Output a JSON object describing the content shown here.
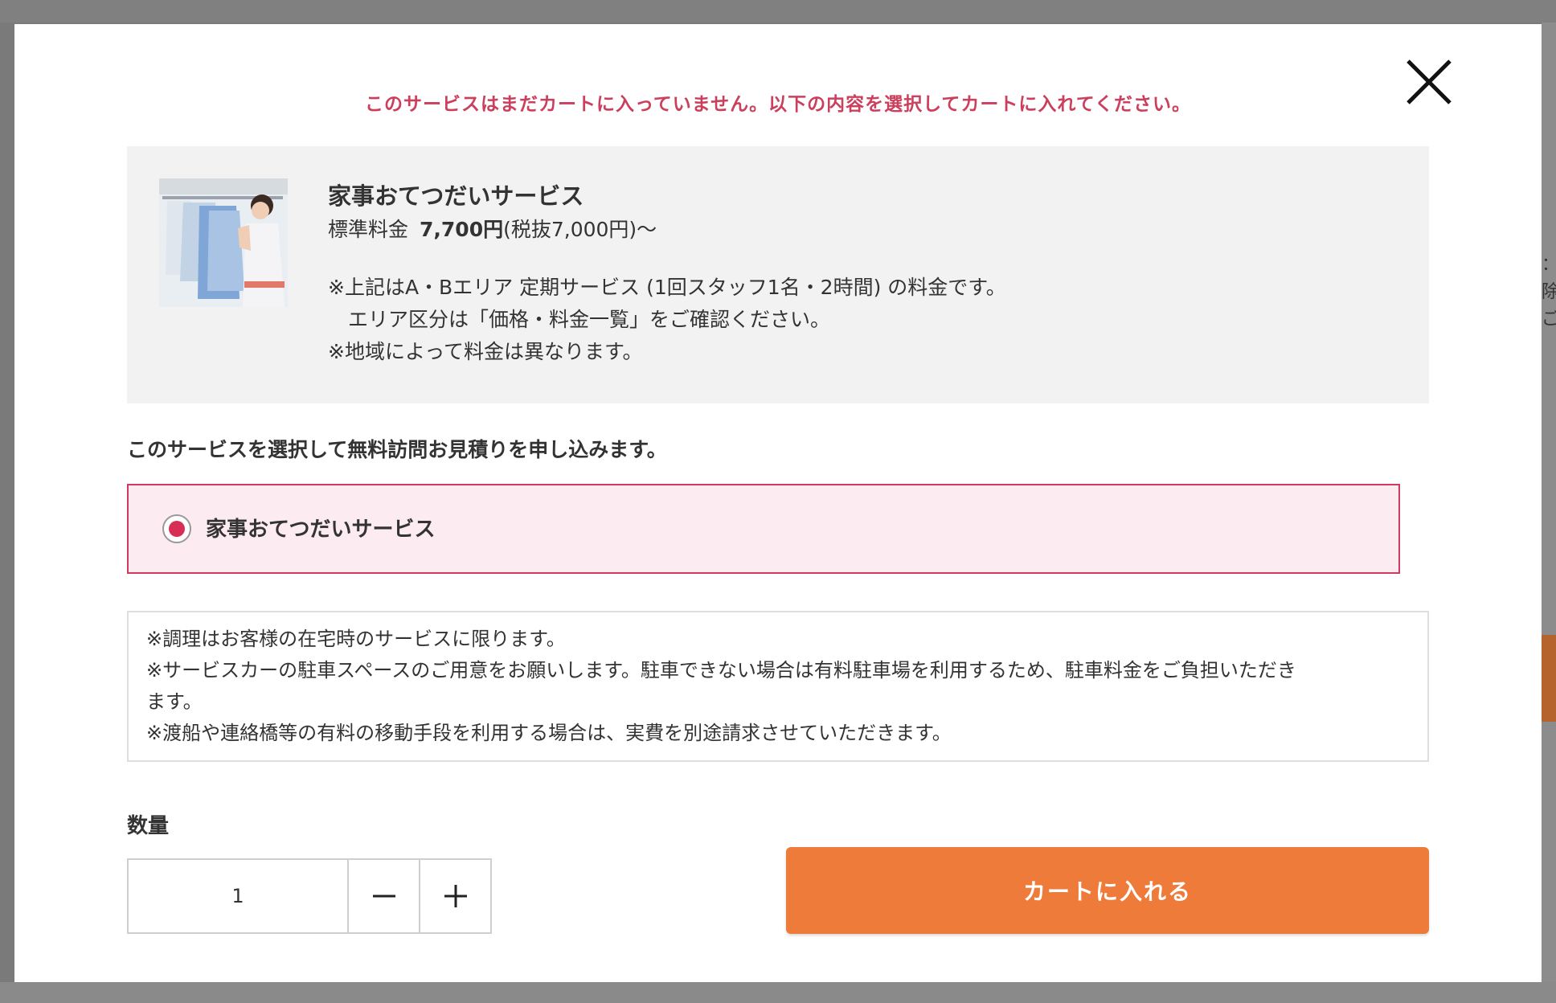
{
  "modal": {
    "notice": "このサービスはまだカートに入っていません。以下の内容を選択してカートに入れてください。",
    "close_icon": "close-icon"
  },
  "service": {
    "title": "家事おてつだいサービス",
    "price_label": "標準料金",
    "price": "7,700円",
    "price_tax_note": "(税抜7,000円)～",
    "notes": [
      "※上記はA・Bエリア 定期サービス (1回スタッフ1名・2時間) の料金です。",
      "　エリア区分は「価格・料金一覧」をご確認ください。",
      "※地域によって料金は異なります。"
    ]
  },
  "selection": {
    "heading": "このサービスを選択して無料訪問お見積りを申し込みます。",
    "option_label": "家事おてつだいサービス",
    "selected": true
  },
  "terms": [
    "※調理はお客様の在宅時のサービスに限ります。",
    "※サービスカーの駐車スペースのご用意をお願いします。駐車できない場合は有料駐車場を利用するため、駐車料金をご負担いただき",
    "ます。",
    "※渡船や連絡橋等の有料の移動手段を利用する場合は、実費を別途請求させていただきます。"
  ],
  "quantity": {
    "label": "数量",
    "value": "1"
  },
  "cart": {
    "button_label": "カートに入れる"
  },
  "colors": {
    "accent": "#cc3f5c",
    "cart_button": "#ef7b3b",
    "option_bg": "#fcecf1"
  }
}
